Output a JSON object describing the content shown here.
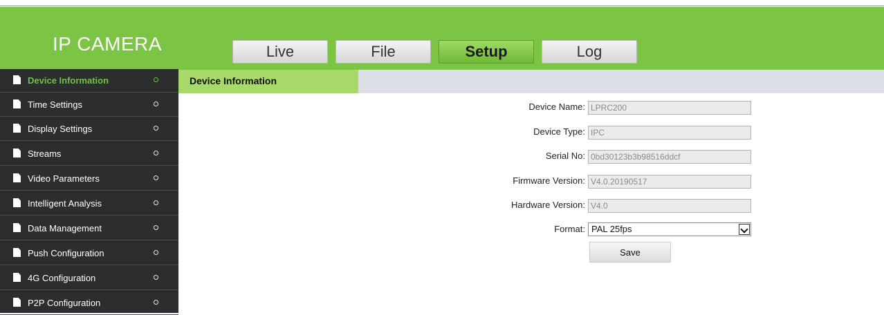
{
  "header": {
    "logo": "IP CAMERA",
    "nav": [
      "Live",
      "File",
      "Setup",
      "Log"
    ],
    "active_nav": "Setup"
  },
  "sidebar": {
    "items": [
      {
        "label": "Device Information",
        "active": true
      },
      {
        "label": "Time Settings"
      },
      {
        "label": "Display Settings"
      },
      {
        "label": "Streams"
      },
      {
        "label": "Video Parameters"
      },
      {
        "label": "Intelligent Analysis"
      },
      {
        "label": "Data Management"
      },
      {
        "label": "Push Configuration"
      },
      {
        "label": "4G Configuration"
      },
      {
        "label": "P2P Configuration"
      }
    ]
  },
  "content": {
    "tab_title": "Device Information",
    "fields": [
      {
        "label": "Device Name:",
        "value": "LPRC200"
      },
      {
        "label": "Device Type:",
        "value": "IPC"
      },
      {
        "label": "Serial No:",
        "value": "0bd30123b3b98516ddcf"
      },
      {
        "label": "Firmware Version:",
        "value": "V4.0.20190517"
      },
      {
        "label": "Hardware Version:",
        "value": "V4.0"
      }
    ],
    "format": {
      "label": "Format:",
      "value": "PAL 25fps"
    },
    "save_label": "Save"
  },
  "colors": {
    "header_green": "#7cc443",
    "sidebar_bg": "#2c2d2f",
    "active_green": "#6fc24a",
    "tab_green": "#a8d96b"
  }
}
